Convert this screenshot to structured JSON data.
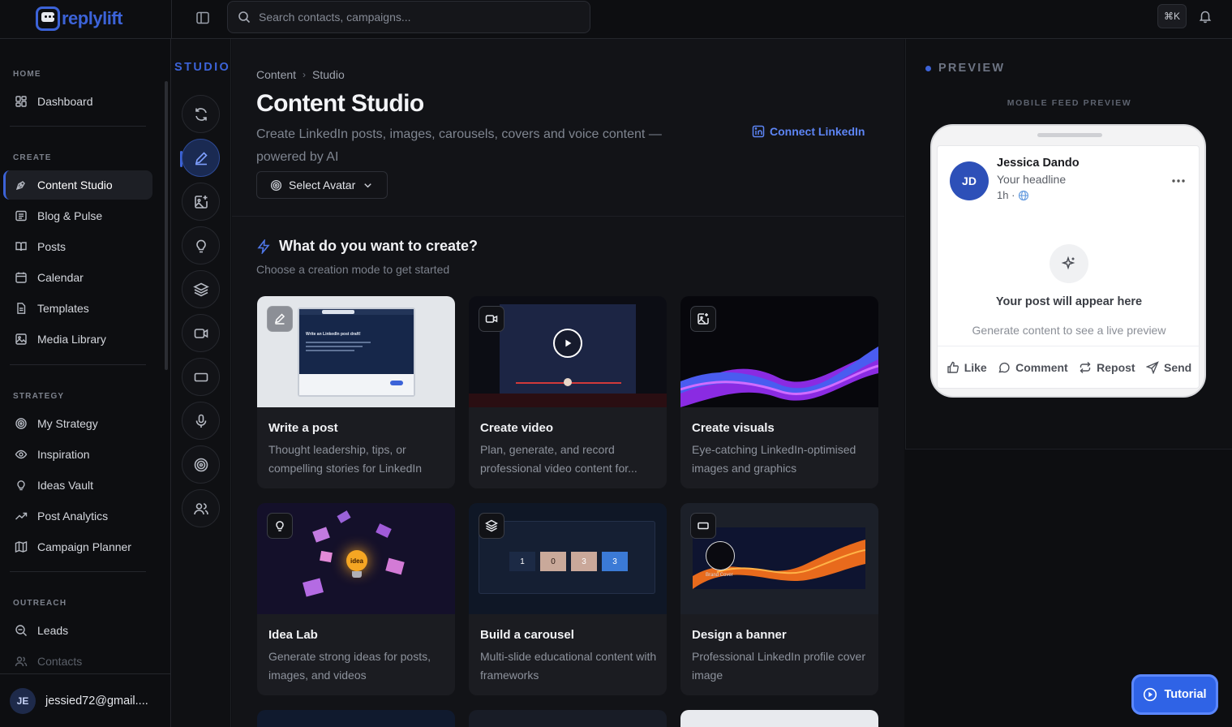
{
  "app": {
    "name": "replylift"
  },
  "topbar": {
    "search_placeholder": "Search contacts, campaigns...",
    "shortcut": "⌘K"
  },
  "sidebar": {
    "sections": {
      "home": "HOME",
      "create": "CREATE",
      "strategy": "STRATEGY",
      "outreach": "OUTREACH"
    },
    "items": {
      "dashboard": "Dashboard",
      "content_studio": "Content Studio",
      "blog_pulse": "Blog & Pulse",
      "posts": "Posts",
      "calendar": "Calendar",
      "templates": "Templates",
      "media_library": "Media Library",
      "my_strategy": "My Strategy",
      "inspiration": "Inspiration",
      "ideas_vault": "Ideas Vault",
      "post_analytics": "Post Analytics",
      "campaign_planner": "Campaign Planner",
      "leads": "Leads",
      "contacts": "Contacts"
    },
    "active": "content_studio",
    "user": {
      "initials": "JE",
      "email": "jessied72@gmail...."
    }
  },
  "rail": {
    "title": "STUDIO"
  },
  "main": {
    "breadcrumb": [
      "Content",
      "Studio"
    ],
    "title": "Content Studio",
    "subtitle": "Create LinkedIn posts, images, carousels, covers and voice content — powered by AI",
    "connect_label": "Connect LinkedIn",
    "avatar_select": "Select Avatar",
    "create_title": "What do you want to create?",
    "create_subtitle": "Choose a creation mode to get started",
    "cards": [
      {
        "title": "Write a post",
        "description": "Thought leadership, tips, or compelling stories for LinkedIn",
        "icon": "pencil-icon"
      },
      {
        "title": "Create video",
        "description": "Plan, generate, and record professional video content for...",
        "icon": "video-icon"
      },
      {
        "title": "Create visuals",
        "description": "Eye-catching LinkedIn-optimised images and graphics",
        "icon": "image-plus-icon"
      },
      {
        "title": "Idea Lab",
        "description": "Generate strong ideas for posts, images, and videos",
        "icon": "lightbulb-icon"
      },
      {
        "title": "Build a carousel",
        "description": "Multi-slide educational content with frameworks",
        "icon": "layers-icon"
      },
      {
        "title": "Design a banner",
        "description": "Professional LinkedIn profile cover image",
        "icon": "rectangle-icon"
      }
    ],
    "thumb_text": {
      "post_heading": "Write an LinkedIn post draft!",
      "carousel_slides": [
        "1",
        "0",
        "3",
        "3"
      ],
      "idea_label": "idea",
      "banner_caption": "Brand Cover"
    }
  },
  "preview": {
    "title": "PREVIEW",
    "mobile_label": "MOBILE FEED PREVIEW",
    "author_initials": "JD",
    "author_name": "Jessica Dando",
    "headline": "Your headline",
    "time": "1h ·",
    "empty_title": "Your post will appear here",
    "empty_subtitle": "Generate content to see a live preview",
    "actions": [
      "Like",
      "Comment",
      "Repost",
      "Send"
    ]
  },
  "tutorial": {
    "label": "Tutorial"
  },
  "colors": {
    "accent": "#3c63d8",
    "background": "#0d0e11",
    "link": "#5d85f5"
  }
}
